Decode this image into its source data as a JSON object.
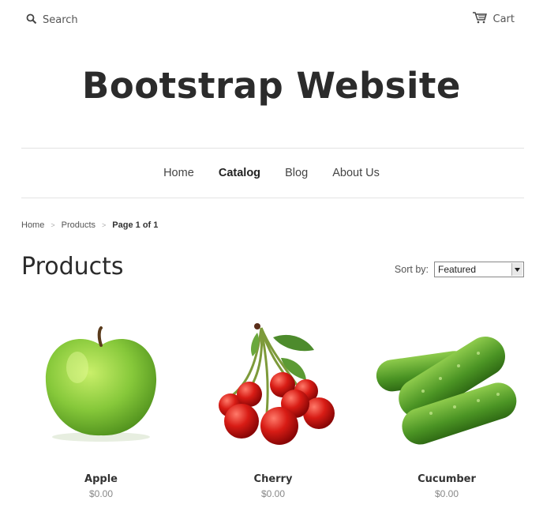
{
  "header": {
    "search_label": "Search",
    "cart_label": "Cart",
    "site_title": "Bootstrap Website"
  },
  "nav": {
    "items": [
      {
        "label": "Home"
      },
      {
        "label": "Catalog"
      },
      {
        "label": "Blog"
      },
      {
        "label": "About Us"
      }
    ],
    "active": "Catalog"
  },
  "breadcrumb": {
    "items": [
      "Home",
      "Products"
    ],
    "separator": ">",
    "current": "Page 1 of 1"
  },
  "main": {
    "heading": "Products",
    "sort_label": "Sort by:",
    "sort_selected": "Featured"
  },
  "products": [
    {
      "name": "Apple",
      "price": "$0.00",
      "image": "green-apple"
    },
    {
      "name": "Cherry",
      "price": "$0.00",
      "image": "cherries"
    },
    {
      "name": "Cucumber",
      "price": "$0.00",
      "image": "cucumbers"
    }
  ],
  "colors": {
    "text": "#333333",
    "title": "#2b2b2b",
    "muted": "#888888",
    "rule": "#e3e3e3"
  }
}
